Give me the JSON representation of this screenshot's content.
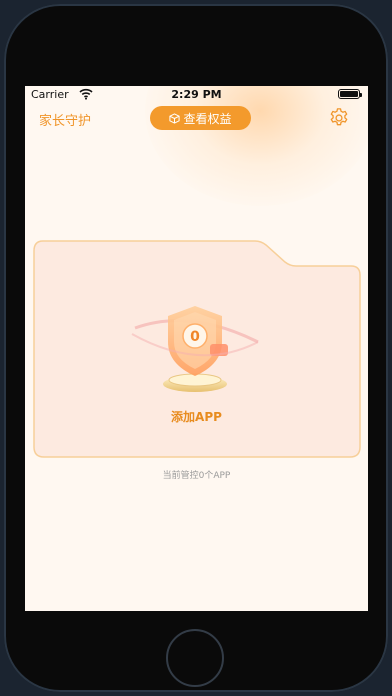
{
  "status_bar": {
    "carrier": "Carrier",
    "time": "2:29 PM",
    "battery_level": 1.0
  },
  "header": {
    "title": "家长守护",
    "rights_button_label": "查看权益",
    "rights_icon": "box-icon",
    "settings_icon": "gear-icon"
  },
  "card": {
    "shield_count": "0",
    "add_label": "添加APP"
  },
  "footer_note": "当前管控0个APP",
  "colors": {
    "accent": "#f39a2c",
    "title_orange": "#f0952a",
    "background": "#fff8f1",
    "card_fill": "#fdeae0",
    "card_border": "#f7cf99"
  }
}
